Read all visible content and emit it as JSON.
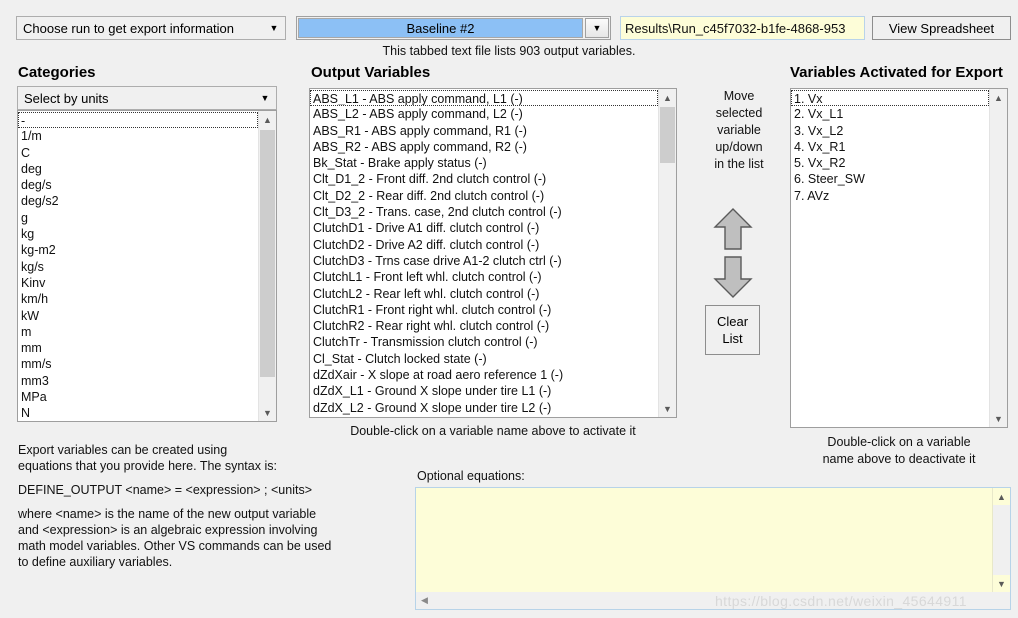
{
  "toolbar": {
    "run_selector_label": "Choose run to get export information",
    "run_value": "Baseline #2",
    "results_path": "Results\\Run_c45f7032-b1fe-4868-953",
    "view_spreadsheet_label": "View Spreadsheet",
    "file_info": "This tabbed text file lists 903 output variables."
  },
  "categories": {
    "heading": "Categories",
    "select_value": "Select by units",
    "items": [
      "-",
      "1/m",
      "C",
      "deg",
      "deg/s",
      "deg/s2",
      "g",
      "kg",
      "kg-m2",
      "kg/s",
      "Kinv",
      "km/h",
      "kW",
      "m",
      "mm",
      "mm/s",
      "mm3",
      "MPa",
      "N"
    ],
    "selected_index": 0
  },
  "output_variables": {
    "heading": "Output Variables",
    "items": [
      "ABS_L1 - ABS apply command, L1 (-)",
      "ABS_L2 - ABS apply command, L2 (-)",
      "ABS_R1 - ABS apply command, R1 (-)",
      "ABS_R2 - ABS apply command, R2 (-)",
      "Bk_Stat - Brake apply status (-)",
      "Clt_D1_2 - Front diff. 2nd clutch control (-)",
      "Clt_D2_2 - Rear diff. 2nd clutch control (-)",
      "Clt_D3_2 - Trans. case, 2nd clutch control (-)",
      "ClutchD1 - Drive A1 diff. clutch control (-)",
      "ClutchD2 - Drive A2 diff. clutch control (-)",
      "ClutchD3 - Trns case drive A1-2 clutch ctrl (-)",
      "ClutchL1 - Front left whl. clutch control (-)",
      "ClutchL2 - Rear left whl. clutch control (-)",
      "ClutchR1 - Front right whl. clutch control (-)",
      "ClutchR2 - Rear right whl. clutch control (-)",
      "ClutchTr - Transmission clutch control (-)",
      "Cl_Stat - Clutch locked state (-)",
      "dZdXair - X slope at road aero reference 1 (-)",
      "dZdX_L1 - Ground X slope under tire L1 (-)",
      "dZdX_L2 - Ground X slope under tire L2 (-)"
    ],
    "selected_index": 0,
    "hint": "Double-click on a variable name above to activate it"
  },
  "move_panel": {
    "caption_lines": [
      "Move",
      "selected",
      "variable",
      "up/down",
      "in the list"
    ],
    "up_icon": "arrow-up",
    "down_icon": "arrow-down",
    "clear_list_lines": [
      "Clear",
      "List"
    ]
  },
  "activated": {
    "heading": "Variables Activated for Export",
    "items": [
      "1. Vx",
      "2. Vx_L1",
      "3. Vx_L2",
      "4. Vx_R1",
      "5. Vx_R2",
      "6. Steer_SW",
      "7. AVz"
    ],
    "selected_index": 0,
    "hint_lines": [
      "Double-click on a variable",
      "name above to deactivate it"
    ]
  },
  "help": {
    "para1_line1": "Export variables can be created using",
    "para1_line2": "equations that you provide here. The syntax is:",
    "syntax": "DEFINE_OUTPUT <name> = <expression> ; <units>",
    "para2_line1": "where <name> is the name of the new output variable",
    "para2_line2": "and <expression> is an algebraic expression involving",
    "para2_line3": "math model variables. Other VS commands can be used",
    "para2_line4": "to define auxiliary variables."
  },
  "equations": {
    "label": "Optional equations:",
    "value": "",
    "placeholder": ""
  },
  "watermark": "https://blog.csdn.net/weixin_45644911",
  "colors": {
    "window_bg": "#f0f0f0",
    "accent_blue": "#8cc0f5",
    "field_yellow": "#fdfdd8",
    "list_bg": "#ffffff",
    "border_gray": "#9e9e9e"
  }
}
